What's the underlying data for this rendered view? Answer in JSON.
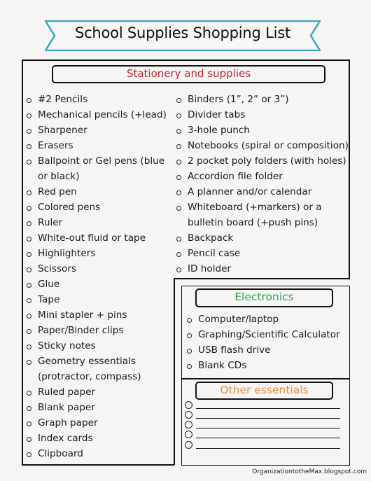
{
  "title": "School Supplies Shopping List",
  "colors": {
    "banner_border": "#3aa6c2",
    "stationery_heading": "#c0262d",
    "electronics_heading": "#2aa24e",
    "other_heading": "#e0924a"
  },
  "sections": {
    "stationery": {
      "heading": "Stationery and supplies",
      "column1": [
        "#2 Pencils",
        "Mechanical pencils (+lead)",
        "Sharpener",
        "Erasers",
        "Ballpoint or Gel pens (blue",
        "or black)",
        "Red pen",
        "Colored pens",
        "Ruler",
        "White-out fluid or tape",
        "Highlighters",
        "Scissors",
        "Glue",
        "Tape",
        "Mini stapler + pins",
        "Paper/Binder clips",
        "Sticky notes",
        "Geometry essentials",
        "(protractor, compass)",
        "Ruled paper",
        "Blank paper",
        "Graph paper",
        "Index cards",
        "Clipboard"
      ],
      "column2": [
        "Binders (1”, 2” or 3”)",
        "Divider tabs",
        "3-hole punch",
        "Notebooks (spiral or composition)",
        "2 pocket poly folders (with holes)",
        "Accordion file folder",
        "A planner and/or calendar",
        "Whiteboard (+markers) or a",
        "bulletin board (+push pins)",
        "Backpack",
        "Pencil case",
        "ID holder"
      ]
    },
    "electronics": {
      "heading": "Electronics",
      "items": [
        "Computer/laptop",
        "Graphing/Scientific Calculator",
        "USB flash drive",
        "Blank CDs"
      ]
    },
    "other": {
      "heading": "Other essentials",
      "blank_lines": 5
    }
  },
  "credit": "OrganizationtotheMax.blogspot.com"
}
